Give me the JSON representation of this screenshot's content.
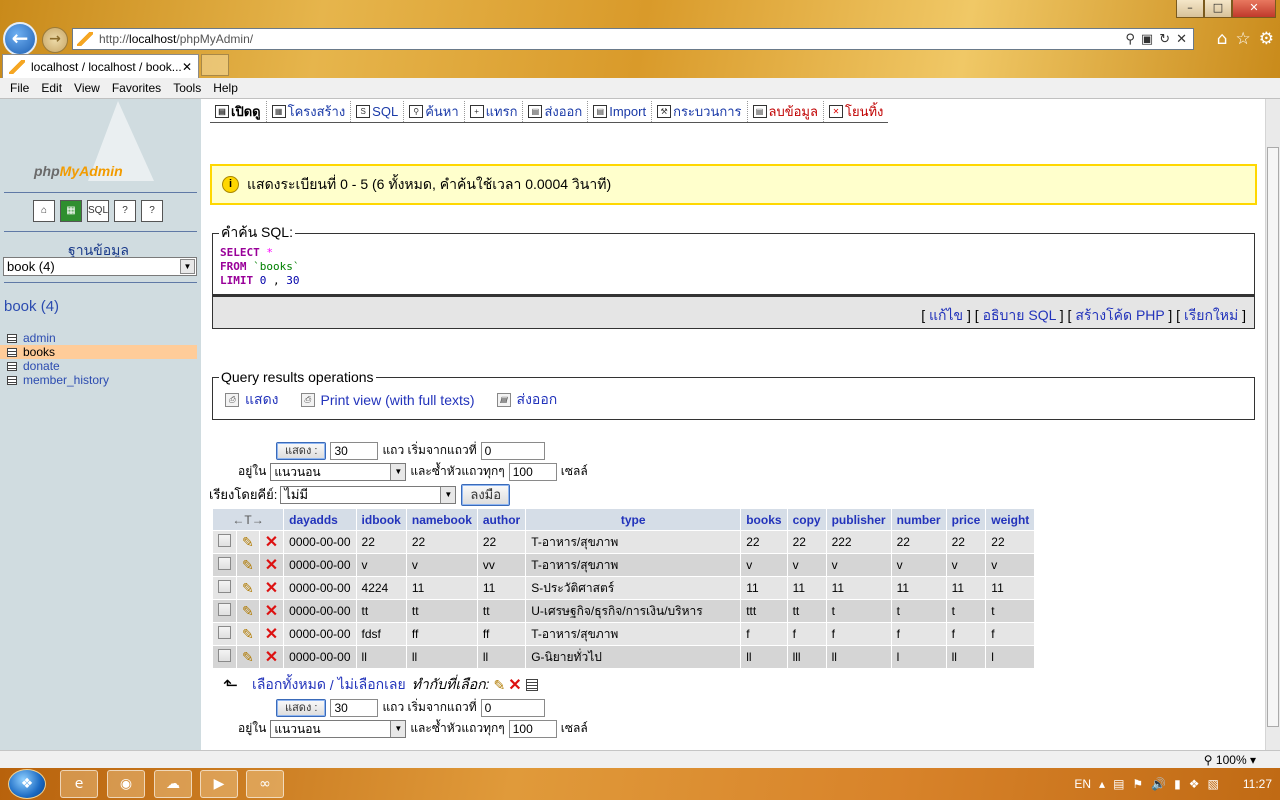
{
  "browser": {
    "window_buttons": [
      "–",
      "□",
      "✕"
    ],
    "url_prefix": "http://",
    "url_host": "localhost",
    "url_path": "/phpMyAdmin/",
    "tab_title": "localhost / localhost / book...",
    "tab_close": "✕",
    "menu": [
      "File",
      "Edit",
      "View",
      "Favorites",
      "Tools",
      "Help"
    ],
    "zoom": "100%"
  },
  "left": {
    "logo_text_a": "php",
    "logo_text_b": "MyAdmin",
    "db_heading": "ฐานข้อมูล",
    "db_select": "book (4)",
    "db_title": "book (4)",
    "tables": [
      "admin",
      "books",
      "donate",
      "member_history"
    ],
    "active_table": "books"
  },
  "topnav": [
    {
      "label": "เปิดดู",
      "icon": "browse-icon"
    },
    {
      "label": "โครงสร้าง",
      "icon": "structure-icon"
    },
    {
      "label": "SQL",
      "icon": "sql-icon"
    },
    {
      "label": "ค้นหา",
      "icon": "search-icon"
    },
    {
      "label": "แทรก",
      "icon": "insert-icon"
    },
    {
      "label": "ส่งออก",
      "icon": "export-icon"
    },
    {
      "label": "Import",
      "icon": "import-icon"
    },
    {
      "label": "กระบวนการ",
      "icon": "operations-icon"
    },
    {
      "label": "ลบข้อมูล",
      "icon": "empty-icon"
    },
    {
      "label": "โยนทิ้ง",
      "icon": "drop-icon"
    }
  ],
  "notice": "แสดงระเบียนที่ 0 - 5 (6 ทั้งหมด, คำค้นใช้เวลา 0.0004 วินาที)",
  "sql": {
    "legend": "คำค้น SQL:",
    "select_kw": "SELECT",
    "star": "*",
    "from_kw": "FROM",
    "table": "`books`",
    "limit_kw": "LIMIT",
    "limit_a": "0",
    "limit_b": "30",
    "links": [
      "แก้ไข",
      "อธิบาย SQL",
      "สร้างโค้ด PHP",
      "เรียกใหม่"
    ]
  },
  "qr": {
    "legend": "Query results operations",
    "print": "แสดง",
    "print_full": "Print view (with full texts)",
    "export": "ส่งออก"
  },
  "nav": {
    "show_btn": "แสดง :",
    "rows": "30",
    "rows_label": "แถว เริ่มจากแถวที่",
    "start": "0",
    "in_label": "อยู่ใน",
    "mode": "แนวนอน",
    "repeat_label": "และซ้ำหัวแถวทุกๆ",
    "repeat": "100",
    "cells_label": "เซลล์",
    "sort_label": "เรียงโดยคีย์:",
    "sort_value": "ไม่มี",
    "go_btn": "ลงมือ"
  },
  "table": {
    "arrow_header": "←T→",
    "columns": [
      "dayadds",
      "idbook",
      "namebook",
      "author",
      "type",
      "books",
      "copy",
      "publisher",
      "number",
      "price",
      "weight"
    ],
    "rows": [
      [
        "0000-00-00",
        "22",
        "22",
        "22",
        "T-อาหาร/สุขภาพ",
        "22",
        "22",
        "222",
        "22",
        "22",
        "22"
      ],
      [
        "0000-00-00",
        "v",
        "v",
        "vv",
        "T-อาหาร/สุขภาพ",
        "v",
        "v",
        "v",
        "v",
        "v",
        "v"
      ],
      [
        "0000-00-00",
        "4224",
        "11",
        "11",
        "S-ประวัติศาสตร์",
        "11",
        "11",
        "11",
        "11",
        "11",
        "11"
      ],
      [
        "0000-00-00",
        "tt",
        "tt",
        "tt",
        "U-เศรษฐกิจ/ธุรกิจ/การเงิน/บริหาร",
        "ttt",
        "tt",
        "t",
        "t",
        "t",
        "t"
      ],
      [
        "0000-00-00",
        "fdsf",
        "ff",
        "ff",
        "T-อาหาร/สุขภาพ",
        "f",
        "f",
        "f",
        "f",
        "f",
        "f"
      ],
      [
        "0000-00-00",
        "ll",
        "ll",
        "ll",
        "G-นิยายทั่วไป",
        "ll",
        "lll",
        "ll",
        "l",
        "ll",
        "l"
      ]
    ]
  },
  "selectall": {
    "check_all": "เลือกทั้งหมด",
    "sep": " / ",
    "uncheck_all": "ไม่เลือกเลย",
    "with_selected": "ทำกับที่เลือก:"
  },
  "taskbar": {
    "lang": "EN",
    "clock": "11:27"
  }
}
